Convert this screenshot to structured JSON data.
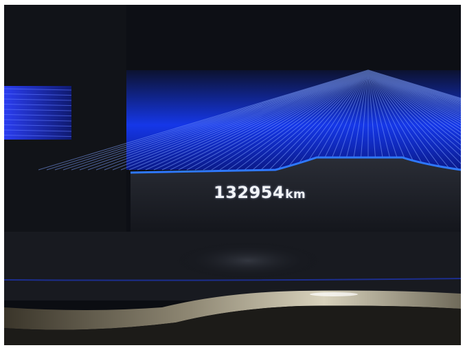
{
  "odometer": {
    "value": "132954",
    "unit": "km"
  },
  "colors": {
    "display_blue": "#1d3dff",
    "glow_blue": "#2b6bff",
    "bezel_black": "#0b0d12",
    "trim_silver": "#b8b09a"
  }
}
